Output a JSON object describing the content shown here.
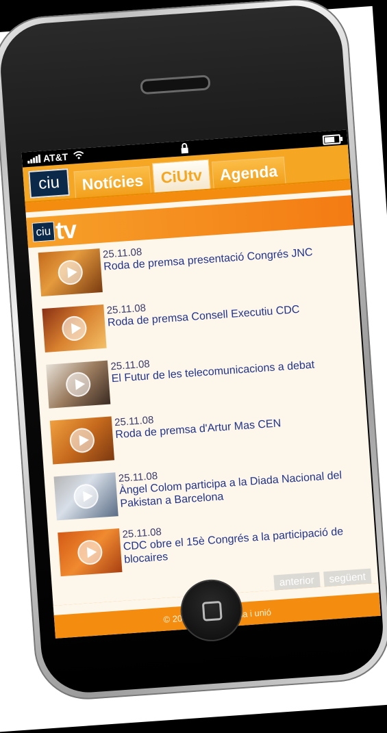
{
  "status_bar": {
    "carrier": "AT&T"
  },
  "nav": {
    "logo_text": "ciu",
    "tabs": [
      {
        "label": "Notícies",
        "active": false
      },
      {
        "label": "CiUtv",
        "active": true
      },
      {
        "label": "Agenda",
        "active": false
      }
    ]
  },
  "section": {
    "logo_box": "ciu",
    "logo_tv": "tv"
  },
  "videos": [
    {
      "date": "25.11.08",
      "title": "Roda de premsa presentació Congrés JNC"
    },
    {
      "date": "25.11.08",
      "title": "Roda de premsa Consell Executiu CDC"
    },
    {
      "date": "25.11.08",
      "title": "El Futur de les telecomunicacions a debat"
    },
    {
      "date": "25.11.08",
      "title": "Roda de premsa d'Artur Mas CEN"
    },
    {
      "date": "25.11.08",
      "title": "Àngel Colom participa a la Diada Nacional del Pakistan a Barcelona"
    },
    {
      "date": "25.11.08",
      "title": "CDC obre el 15è Congrés a la participació de blocaires"
    }
  ],
  "pager": {
    "prev": "anterior",
    "next": "següent"
  },
  "footer": {
    "copyright": "© 2008 convergència i unió"
  },
  "colors": {
    "orange": "#f5a623",
    "dark_orange": "#f38c0f",
    "navy": "#0b2a4a",
    "link_blue": "#22338a"
  }
}
